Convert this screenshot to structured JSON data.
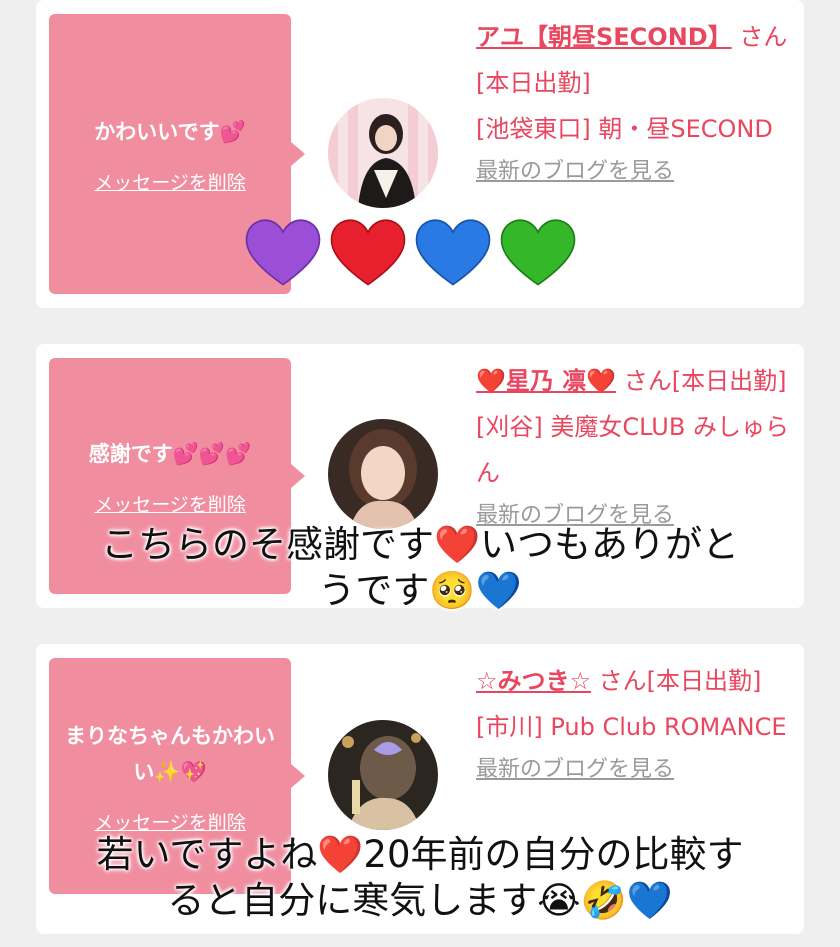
{
  "cards": [
    {
      "bubble_message": "かわいいです💕",
      "bubble_delete": "メッセージを削除",
      "name": "アユ【朝昼SECOND】",
      "san_status": "さん[本日出勤]",
      "shop": "[池袋東口] 朝・昼SECOND",
      "blog_link": "最新のブログを見る"
    },
    {
      "bubble_message": "感謝です💕💕💕",
      "bubble_delete": "メッセージを削除",
      "name": "❤️星乃 凛❤️",
      "san_status": "さん[本日出勤]",
      "shop": "[刈谷] 美魔女CLUB みしゅらん",
      "blog_link": "最新のブログを見る"
    },
    {
      "bubble_message": "まりなちゃんもかわいい✨💖",
      "bubble_delete": "メッセージを削除",
      "name": "☆みつき☆",
      "san_status": "さん[本日出勤]",
      "shop": "[市川] Pub Club ROMANCE",
      "blog_link": "最新のブログを見る"
    }
  ],
  "overlay_captions": {
    "caption_1_line_1": "こちらのそ感謝です❤️いつもありがと",
    "caption_1_line_2": "うです🥺💙",
    "caption_2_line_1": "若いですよね❤️20年前の自分の比較す",
    "caption_2_line_2": "ると自分に寒気します😭🤣💙"
  },
  "big_hearts": [
    "purple-heart",
    "red-heart",
    "blue-heart",
    "green-heart"
  ],
  "colors": {
    "accent": "#e9475f",
    "bubble": "#f08ea0",
    "background": "#efefef",
    "card": "#ffffff",
    "link_gray": "#9a9a9a"
  }
}
